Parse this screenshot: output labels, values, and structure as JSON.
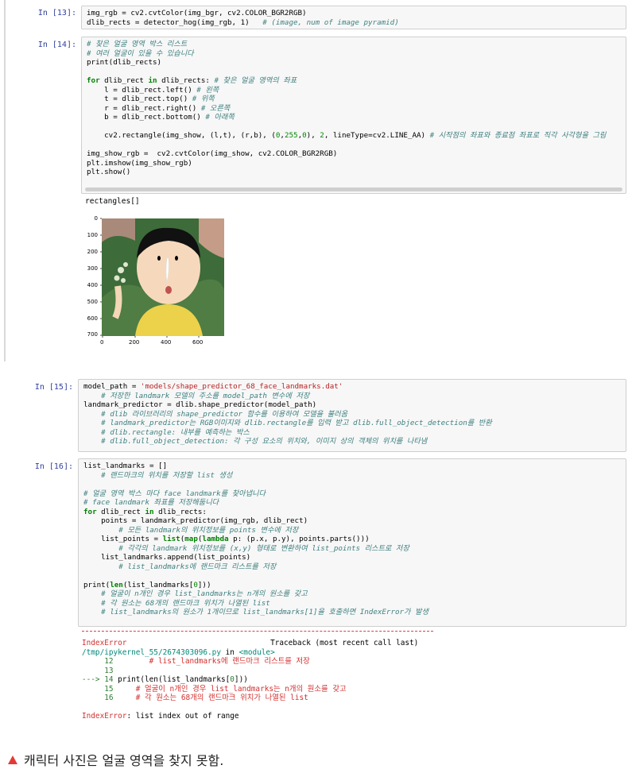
{
  "cells": [
    {
      "prompt": "In [13]:",
      "lines": [
        [
          [
            "",
            "img_rgb = cv2.cvtColor(img_bgr, cv2.COLOR_BGR2RGB)"
          ]
        ],
        [
          [
            "",
            "dlib_rects = detector_hog(img_rgb, 1)   "
          ],
          [
            "cmt",
            "# (image, num of image pyramid)"
          ]
        ]
      ]
    },
    {
      "prompt": "In [14]:",
      "lines": [
        [
          [
            "cmt",
            "# 찾은 얼굴 영역 박스 리스트"
          ]
        ],
        [
          [
            "cmt",
            "# 여러 얼굴이 있을 수 있습니다"
          ]
        ],
        [
          [
            "",
            "print(dlib_rects)"
          ]
        ],
        [],
        [
          [
            "kw",
            "for"
          ],
          [
            "",
            " dlib_rect "
          ],
          [
            "kw",
            "in"
          ],
          [
            "",
            " dlib_rects: "
          ],
          [
            "cmt",
            "# 찾은 얼굴 영역의 좌표"
          ]
        ],
        [
          [
            "",
            "    l = dlib_rect.left() "
          ],
          [
            "cmt",
            "# 왼쪽"
          ]
        ],
        [
          [
            "",
            "    t = dlib_rect.top() "
          ],
          [
            "cmt",
            "# 위쪽"
          ]
        ],
        [
          [
            "",
            "    r = dlib_rect.right() "
          ],
          [
            "cmt",
            "# 오른쪽"
          ]
        ],
        [
          [
            "",
            "    b = dlib_rect.bottom() "
          ],
          [
            "cmt",
            "# 아래쪽"
          ]
        ],
        [],
        [
          [
            "",
            "    cv2.rectangle(img_show, (l,t), (r,b), ("
          ],
          [
            "num",
            "0"
          ],
          [
            "",
            ","
          ],
          [
            "num",
            "255"
          ],
          [
            "",
            ","
          ],
          [
            "num",
            "0"
          ],
          [
            "",
            "), "
          ],
          [
            "num",
            "2"
          ],
          [
            "",
            ", lineType=cv2.LINE_AA) "
          ],
          [
            "cmt",
            "# 시작점의 좌표와 종료점 좌표로 직각 사각형을 그림"
          ]
        ],
        [],
        [
          [
            "",
            "img_show_rgb =  cv2.cvtColor(img_show, cv2.COLOR_BGR2RGB)"
          ]
        ],
        [
          [
            "",
            "plt.imshow(img_show_rgb)"
          ]
        ],
        [
          [
            "",
            "plt.show()"
          ]
        ]
      ],
      "output": "rectangles[]",
      "plot": {
        "y_ticks": [
          "0",
          "100",
          "200",
          "300",
          "400",
          "500",
          "600",
          "700"
        ],
        "x_ticks": [
          "0",
          "200",
          "400",
          "600"
        ]
      }
    },
    {
      "prompt": "In [15]:",
      "lines": [
        [
          [
            "",
            "model_path = "
          ],
          [
            "str",
            "'models/shape_predictor_68_face_landmarks.dat'"
          ]
        ],
        [
          [
            "cmt",
            "    # 저장한 landmark 모델의 주소를 model_path 변수에 저장"
          ]
        ],
        [
          [
            "",
            "landmark_predictor = dlib.shape_predictor(model_path)"
          ]
        ],
        [
          [
            "cmt",
            "    # dlib 라이브러리의 shape_predictor 함수를 이용하여 모델을 불러옴"
          ]
        ],
        [
          [
            "cmt",
            "    # landmark_predictor는 RGB이미지와 dlib.rectangle를 입력 받고 dlib.full_object_detection를 반환"
          ]
        ],
        [
          [
            "cmt",
            "    # dlib.rectangle: 내부를 예측하는 박스"
          ]
        ],
        [
          [
            "cmt",
            "    # dlib.full_object_detection: 각 구성 요소의 위치와, 이미지 상의 객체의 위치를 나타냄"
          ]
        ]
      ]
    },
    {
      "prompt": "In [16]:",
      "lines": [
        [
          [
            "",
            "list_landmarks = []"
          ]
        ],
        [
          [
            "cmt",
            "    # 랜드마크의 위치를 저장할 list 생성"
          ]
        ],
        [],
        [
          [
            "cmt",
            "# 얼굴 영역 박스 마다 face landmark를 찾아냅니다"
          ]
        ],
        [
          [
            "cmt",
            "# face landmark 좌표를 저장해둡니다"
          ]
        ],
        [
          [
            "kw",
            "for"
          ],
          [
            "",
            " dlib_rect "
          ],
          [
            "kw",
            "in"
          ],
          [
            "",
            " dlib_rects:"
          ]
        ],
        [
          [
            "",
            "    points = landmark_predictor(img_rgb, dlib_rect)"
          ]
        ],
        [
          [
            "cmt",
            "        # 모든 landmark의 위치정보를 points 변수에 저장"
          ]
        ],
        [
          [
            "",
            "    list_points = "
          ],
          [
            "kw",
            "list"
          ],
          [
            "",
            "("
          ],
          [
            "kw",
            "map"
          ],
          [
            "",
            "("
          ],
          [
            "kw",
            "lambda"
          ],
          [
            "",
            " p: (p.x, p.y), points.parts()))"
          ]
        ],
        [
          [
            "cmt",
            "        # 각각의 landmark 위치정보를 (x,y) 형태로 변환하여 list_points 리스트로 저장"
          ]
        ],
        [
          [
            "",
            "    list_landmarks.append(list_points)"
          ]
        ],
        [
          [
            "cmt",
            "        # list_landmarks에 랜드마크 리스트를 저장"
          ]
        ],
        [],
        [
          [
            "",
            "print("
          ],
          [
            "kw",
            "len"
          ],
          [
            "",
            "(list_landmarks["
          ],
          [
            "num",
            "0"
          ],
          [
            "",
            "]))"
          ]
        ],
        [
          [
            "cmt",
            "    # 얼굴이 n개인 경우 list_landmarks는 n개의 원소를 갖고"
          ]
        ],
        [
          [
            "cmt",
            "    # 각 원소는 68개의 랜드마크 위치가 나열된 list"
          ]
        ],
        [
          [
            "cmt",
            "    # list_landmarks의 원소가 1개이므로 list_landmarks[1]을 호출하면 IndexError가 발생"
          ]
        ]
      ],
      "traceback": [
        [
          [
            "err",
            "IndexError"
          ],
          [
            "",
            "                                Traceback (most recent call last)"
          ]
        ],
        [
          [
            "path",
            "/tmp/ipykernel_55/2674303096.py"
          ],
          [
            "",
            " in "
          ],
          [
            "path",
            "<module>"
          ]
        ],
        [
          [
            "lnum",
            "     12"
          ],
          [
            "err",
            "        # list_landmarks에 랜드마크 리스트를 저장"
          ]
        ],
        [
          [
            "lnum",
            "     13"
          ]
        ],
        [
          [
            "lnum",
            "---> 14 "
          ],
          [
            "",
            "print(len(list_landmarks["
          ],
          [
            "lnum",
            "0"
          ],
          [
            "",
            "]))"
          ]
        ],
        [
          [
            "lnum",
            "     15"
          ],
          [
            "err",
            "     # 얼굴이 n개인 경우 list_landmarks는 n개의 원소를 갖고"
          ]
        ],
        [
          [
            "lnum",
            "     16"
          ],
          [
            "err",
            "     # 각 원소는 68개의 랜드마크 위치가 나열된 list"
          ]
        ],
        [],
        [
          [
            "err",
            "IndexError"
          ],
          [
            "",
            ": list index out of range"
          ]
        ]
      ]
    }
  ],
  "caption": "캐릭터 사진은 얼굴 영역을 찾지 못함."
}
